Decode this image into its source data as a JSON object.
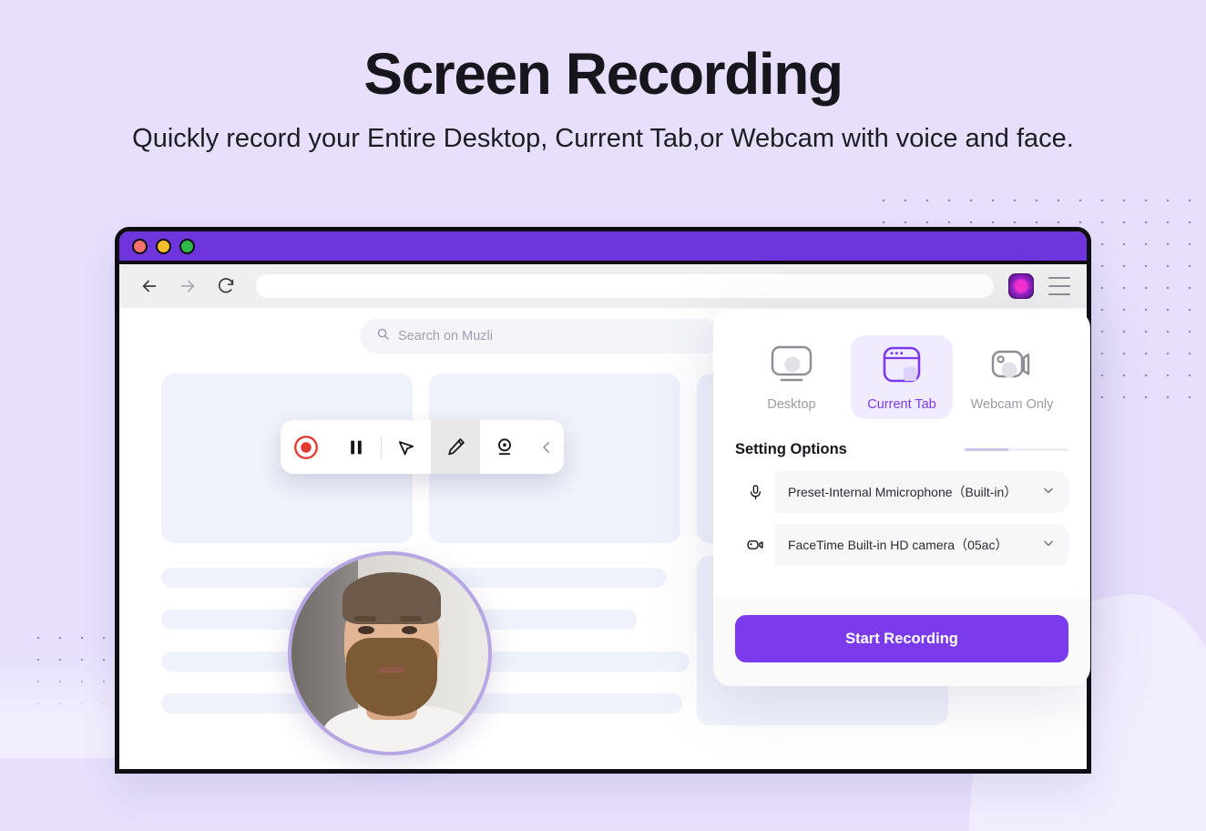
{
  "theme": {
    "background": "#e7dffc",
    "accent_purple": "#7c3aed",
    "title_bar_purple": "#6f35dd",
    "record_red": "#e03b32",
    "webcam_ring": "#b6a6e4"
  },
  "hero": {
    "title": "Screen Recording",
    "subtitle": "Quickly record your Entire Desktop, Current Tab,or Webcam with voice and face."
  },
  "browser": {
    "title_bar": {
      "traffic_lights": [
        {
          "name": "close",
          "color": "#f4736f"
        },
        {
          "name": "minimize",
          "color": "#f6bd2e"
        },
        {
          "name": "zoom",
          "color": "#2fb94b"
        }
      ]
    },
    "nav": {
      "back_icon": "arrow-left-icon",
      "forward_icon": "arrow-right-icon",
      "reload_icon": "reload-icon",
      "url_value": "",
      "url_placeholder": "",
      "extension_icon": "extension-icon",
      "menu_icon": "hamburger-menu-icon"
    }
  },
  "page": {
    "search": {
      "icon": "search-icon",
      "placeholder": "Search on Muzli",
      "value": ""
    },
    "cards": [
      {
        "id": "card-1"
      },
      {
        "id": "card-2"
      },
      {
        "id": "card-3"
      },
      {
        "id": "card-4"
      }
    ],
    "skeleton_bars": [
      {
        "id": "bar-1"
      },
      {
        "id": "bar-2"
      },
      {
        "id": "bar-3"
      },
      {
        "id": "bar-4"
      }
    ]
  },
  "recorder_toolbar": {
    "buttons": [
      {
        "name": "record-button",
        "icon": "record-dot-icon",
        "active": false
      },
      {
        "name": "pause-button",
        "icon": "pause-icon",
        "active": false
      },
      {
        "name": "cursor-tool-button",
        "icon": "cursor-arrow-icon",
        "active": false
      },
      {
        "name": "pen-tool-button",
        "icon": "pencil-icon",
        "active": true
      },
      {
        "name": "webcam-button",
        "icon": "webcam-person-icon",
        "active": false
      },
      {
        "name": "collapse-button",
        "icon": "chevron-left-icon",
        "active": false
      }
    ]
  },
  "webcam_bubble": {
    "name": "webcam-preview-bubble"
  },
  "settings_panel": {
    "modes": [
      {
        "label": "Desktop",
        "icon": "monitor-icon",
        "selected": false
      },
      {
        "label": "Current Tab",
        "icon": "browser-tab-icon",
        "selected": true
      },
      {
        "label": "Webcam Only",
        "icon": "video-camera-icon",
        "selected": false
      }
    ],
    "setting_options_title": "Setting Options",
    "slider_fill_percent": 42,
    "devices": [
      {
        "icon": "microphone-icon",
        "label": "Preset-Internal Mmicrophone（Built-in）",
        "chevron": "chevron-down-icon"
      },
      {
        "icon": "video-camera-icon",
        "label": "FaceTime Built-in HD camera（05ac）",
        "chevron": "chevron-down-icon"
      }
    ],
    "start_button_label": "Start Recording"
  }
}
